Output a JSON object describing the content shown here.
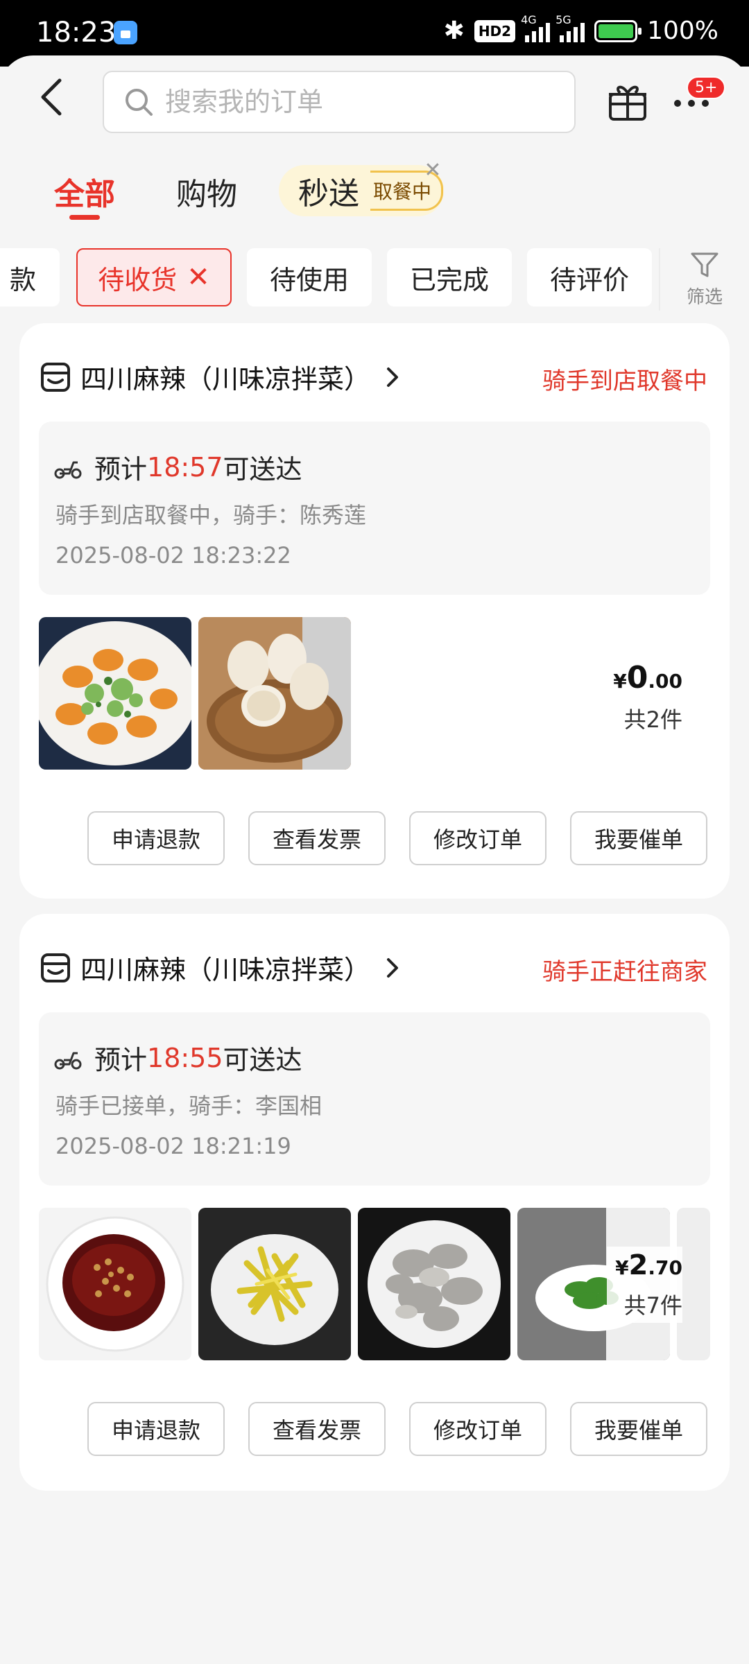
{
  "status_bar": {
    "time": "18:23",
    "hd_label": "HD2",
    "net_4g": "4G",
    "net_5g": "5G",
    "battery": "100%"
  },
  "header": {
    "search_placeholder": "搜索我的订单",
    "badge": "5+"
  },
  "tabs": [
    {
      "label": "全部",
      "active": true
    },
    {
      "label": "购物",
      "active": false
    }
  ],
  "express_tab": {
    "label": "秒送",
    "tag": "取餐中"
  },
  "chips": [
    {
      "label": "款"
    },
    {
      "label": "待收货",
      "selected": true
    },
    {
      "label": "待使用"
    },
    {
      "label": "已完成"
    },
    {
      "label": "待评价"
    }
  ],
  "filter": {
    "label": "筛选"
  },
  "orders": [
    {
      "store": "四川麻辣（川味凉拌菜）",
      "status": "骑手到店取餐中",
      "eta_prefix": "预计",
      "eta_time": "18:57",
      "eta_suffix": "可送达",
      "rider_line": "骑手到店取餐中，骑手：陈秀莲",
      "timestamp": "2025-08-02 18:23:22",
      "price_symbol": "¥",
      "price_int": "0",
      "price_dec": ".00",
      "qty": "共2件"
    },
    {
      "store": "四川麻辣（川味凉拌菜）",
      "status": "骑手正赶往商家",
      "eta_prefix": "预计",
      "eta_time": "18:55",
      "eta_suffix": "可送达",
      "rider_line": "骑手已接单，骑手：李国相",
      "timestamp": "2025-08-02 18:21:19",
      "price_symbol": "¥",
      "price_int": "2",
      "price_dec": ".70",
      "qty": "共7件"
    }
  ],
  "actions": {
    "refund": "申请退款",
    "invoice": "查看发票",
    "modify": "修改订单",
    "urge": "我要催单"
  },
  "colors": {
    "accent_red": "#e8332a",
    "status_red": "#e0382b",
    "pill_bg": "#fdf5d8"
  }
}
